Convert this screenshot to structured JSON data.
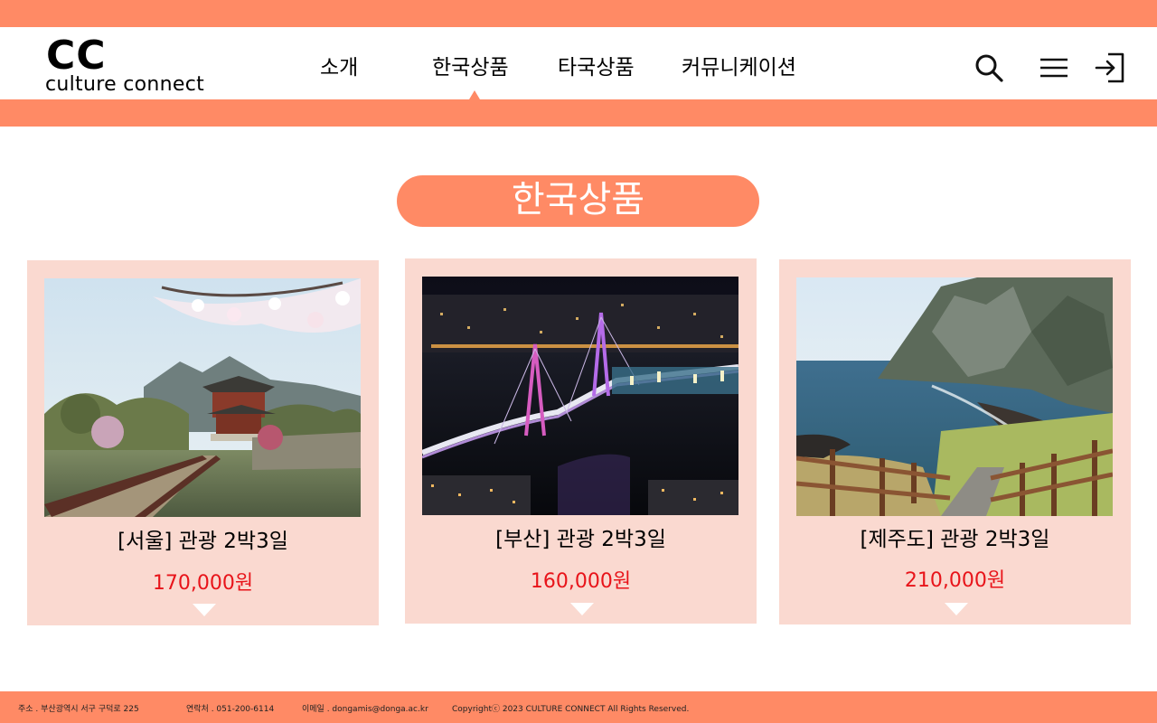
{
  "colors": {
    "accent": "#FF8A65",
    "card_bg": "#FAD9D0",
    "price": "#E8141A"
  },
  "logo": {
    "mark": "CC",
    "text": "culture connect"
  },
  "nav": {
    "items": [
      {
        "label": "소개"
      },
      {
        "label": "한국상품",
        "active": true
      },
      {
        "label": "타국상품"
      },
      {
        "label": "커뮤니케이션"
      }
    ]
  },
  "header_icons": [
    "search-icon",
    "menu-icon",
    "login-icon"
  ],
  "section": {
    "title": "한국상품"
  },
  "products": [
    {
      "title": "[서울] 관광 2박3일",
      "price": "170,000원",
      "image": "Seoul palace pavilion with cherry blossoms"
    },
    {
      "title": "[부산] 관광 2박3일",
      "price": "160,000원",
      "image": "Busan bridge at night"
    },
    {
      "title": "[제주도] 관광 2박3일",
      "price": "210,000원",
      "image": "Jeju coastal cliff and wooden stairway"
    }
  ],
  "footer": {
    "address": "주소 . 부산광역시 서구 구덕로 225",
    "contact": "연락처 . 051-200-6114",
    "email": "이메일 . dongamis@donga.ac.kr",
    "copyright": "Copyrightⓒ 2023 CULTURE CONNECT All Rights Reserved."
  }
}
